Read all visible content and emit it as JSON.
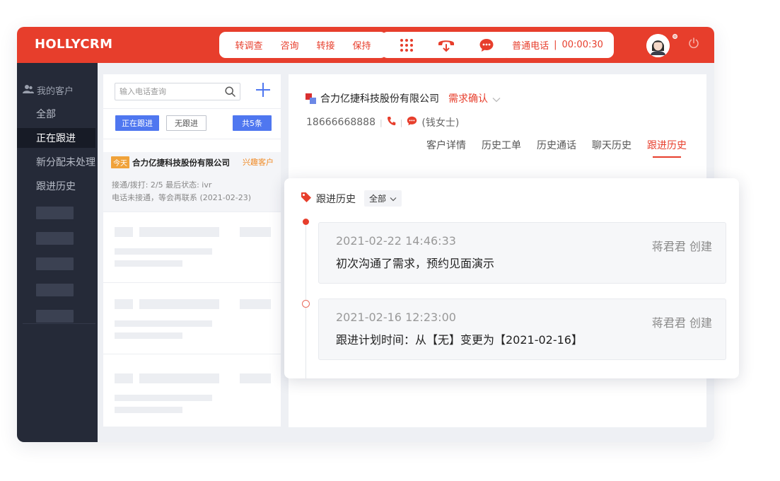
{
  "app": {
    "brand": "HOLLYCRM"
  },
  "topbar": {
    "actions": [
      "转调查",
      "咨询",
      "转接",
      "保持"
    ],
    "icons": [
      "dialpad-icon",
      "hangup-icon",
      "chat-icon"
    ],
    "call_type": "普通电话",
    "call_timer": "00:00:30",
    "accent_color": "#e73e2c"
  },
  "sidebar": {
    "section_title": "我的客户",
    "items": [
      {
        "label": "全部",
        "active": false
      },
      {
        "label": "正在跟进",
        "active": true
      },
      {
        "label": "新分配未处理",
        "active": false
      },
      {
        "label": "跟进历史",
        "active": false
      }
    ]
  },
  "list": {
    "search_placeholder": "输入电话查询",
    "filters": {
      "following": "正在跟进",
      "not_following": "无跟进",
      "total": "共5条"
    },
    "card": {
      "badge": "今天",
      "company": "合力亿捷科技股份有限公司",
      "tag": "兴趣客户",
      "line1": "接通/拨打:  2/5   最后状态: ivr",
      "line2": "电话未接通，等会再联系 (2021-02-23)"
    }
  },
  "detail": {
    "company": "合力亿捷科技股份有限公司",
    "stage": "需求确认",
    "phone": "18666668888",
    "contact": "(钱女士)",
    "tabs": [
      {
        "label": "客户详情",
        "active": false
      },
      {
        "label": "历史工单",
        "active": false
      },
      {
        "label": "历史通话",
        "active": false
      },
      {
        "label": "聊天历史",
        "active": false
      },
      {
        "label": "跟进历史",
        "active": true
      }
    ]
  },
  "history": {
    "title": "跟进历史",
    "filter": "全部",
    "entries": [
      {
        "time": "2021-02-22 14:46:33",
        "author": "蒋君君 创建",
        "content": "初次沟通了需求，预约见面演示"
      },
      {
        "time": "2021-02-16 12:23:00",
        "author": "蒋君君 创建",
        "content": "跟进计划时间：从【无】变更为【2021-02-16】"
      }
    ]
  }
}
